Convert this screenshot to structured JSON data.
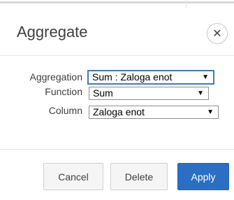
{
  "dialog": {
    "title": "Aggregate",
    "close_glyph": "✕"
  },
  "form": {
    "aggregation": {
      "label": "Aggregation",
      "value": "Sum : Zaloga enot"
    },
    "function": {
      "label": "Function",
      "value": "Sum"
    },
    "column": {
      "label": "Column",
      "value": "Zaloga enot"
    }
  },
  "actions": {
    "cancel": "Cancel",
    "delete": "Delete",
    "apply": "Apply"
  },
  "icons": {
    "close": "close-icon",
    "dropdown": "chevron-down-icon"
  },
  "colors": {
    "primary": "#2b6fc4",
    "focus": "#3c7cc0"
  }
}
